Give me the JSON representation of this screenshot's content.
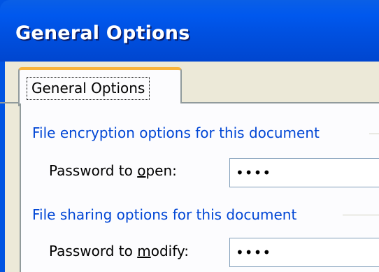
{
  "window": {
    "title": "General Options"
  },
  "tabs": [
    {
      "label": "General Options"
    }
  ],
  "encryption": {
    "group_title": "File encryption options for this document",
    "password_label_pre": "Password to ",
    "password_label_accel": "o",
    "password_label_post": "pen:",
    "password_value": "••••"
  },
  "sharing": {
    "group_title": "File sharing options for this document",
    "password_label_pre": "Password to ",
    "password_label_accel": "m",
    "password_label_post": "odify:",
    "password_value": "••••"
  }
}
